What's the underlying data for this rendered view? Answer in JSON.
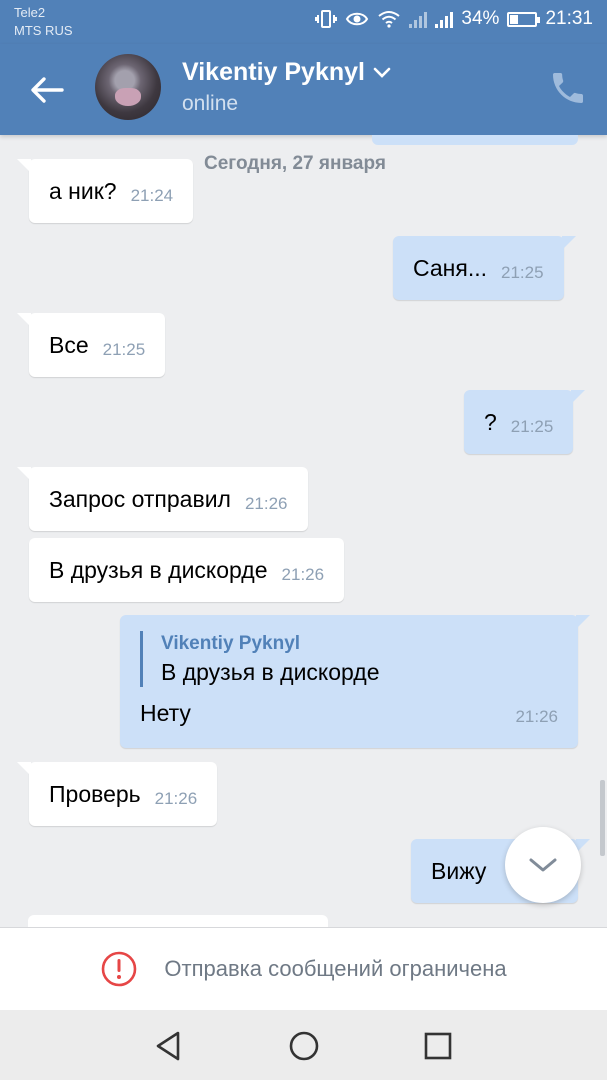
{
  "status_bar": {
    "carrier_1": "Tele2",
    "carrier_2": "MTS RUS",
    "battery_percent": "34%",
    "battery_level": 0.34,
    "time": "21:31"
  },
  "header": {
    "contact_name": "Vikentiy Pyknyl",
    "contact_status": "online",
    "back_icon": "arrow-left-icon",
    "call_icon": "phone-icon"
  },
  "chat": {
    "date_separator": "Сегодня, 27 января",
    "messages": [
      {
        "dir": "in",
        "text": "а ник?",
        "time": "21:24"
      },
      {
        "dir": "out",
        "text": "Саня...",
        "time": "21:25"
      },
      {
        "dir": "in",
        "text": "Все",
        "time": "21:25"
      },
      {
        "dir": "out",
        "text": "?",
        "time": "21:25"
      },
      {
        "dir": "in",
        "text": "Запрос отправил",
        "time": "21:26"
      },
      {
        "dir": "in",
        "text": "В друзья в дискорде",
        "time": "21:26"
      },
      {
        "dir": "out",
        "reply_author": "Vikentiy Pyknyl",
        "reply_text": "В друзья в дискорде",
        "text": "Нету",
        "time": "21:26"
      },
      {
        "dir": "in",
        "text": "Проверь",
        "time": "21:26"
      },
      {
        "dir": "out",
        "text": "Вижу",
        "time": ""
      }
    ]
  },
  "restriction": {
    "text": "Отправка сообщений ограничена",
    "icon": "alert-circle-icon"
  },
  "navigation": {
    "back_icon": "triangle-back-icon",
    "home_icon": "circle-home-icon",
    "recents_icon": "square-recents-icon"
  },
  "colors": {
    "header": "#5181b8",
    "outgoing_bubble": "#cce0f8",
    "incoming_bubble": "#ffffff",
    "background": "#edeef0",
    "alert": "#e64646"
  }
}
